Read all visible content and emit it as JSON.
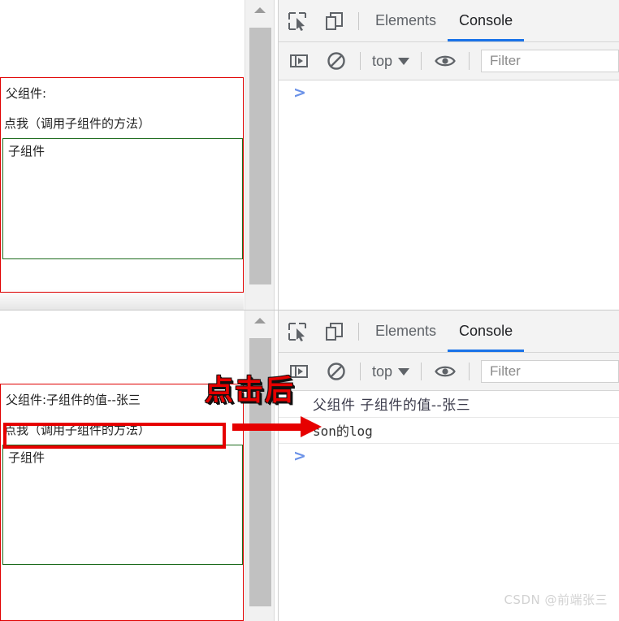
{
  "annotation": {
    "callout_text": "点击后",
    "arrow": "red-right-arrow",
    "highlight_target": "点我（调用子组件的方法）"
  },
  "watermark": "CSDN @前端张三",
  "panes": [
    {
      "id": "before",
      "page": {
        "parent_label": "父组件:",
        "parent_button": "点我（调用子组件的方法）",
        "child_label": "子组件"
      },
      "devtools": {
        "tabs": [
          {
            "label": "Elements",
            "active": false
          },
          {
            "label": "Console",
            "active": true
          }
        ],
        "toolbar": {
          "context": "top",
          "filter_placeholder": "Filter"
        },
        "logs": [],
        "prompt": ">"
      }
    },
    {
      "id": "after",
      "page": {
        "parent_label": "父组件:子组件的值--张三",
        "parent_button": "点我（调用子组件的方法）",
        "child_label": "子组件"
      },
      "devtools": {
        "tabs": [
          {
            "label": "Elements",
            "active": false
          },
          {
            "label": "Console",
            "active": true
          }
        ],
        "toolbar": {
          "context": "top",
          "filter_placeholder": "Filter"
        },
        "logs": [
          {
            "text": "父组件 子组件的值--张三",
            "style": "cjk"
          },
          {
            "text": "son的log",
            "style": "mono"
          }
        ],
        "prompt": ">"
      }
    }
  ],
  "colors": {
    "parent_border": "#e00000",
    "child_border": "#1d6b1d",
    "annotation_red": "#e60000",
    "tab_active_underline": "#1a73e8",
    "prompt_blue": "#6b92e8",
    "scrollbar_thumb": "#c1c1c1",
    "devtools_chrome": "#f3f3f3"
  },
  "icons": {
    "inspect": "inspect-element-icon",
    "device": "device-toolbar-icon",
    "sidebar": "console-sidebar-icon",
    "clear": "clear-console-icon",
    "eye": "live-expression-icon",
    "caret": "chevron-down-icon",
    "scroll_up": "scroll-up-arrow-icon"
  }
}
